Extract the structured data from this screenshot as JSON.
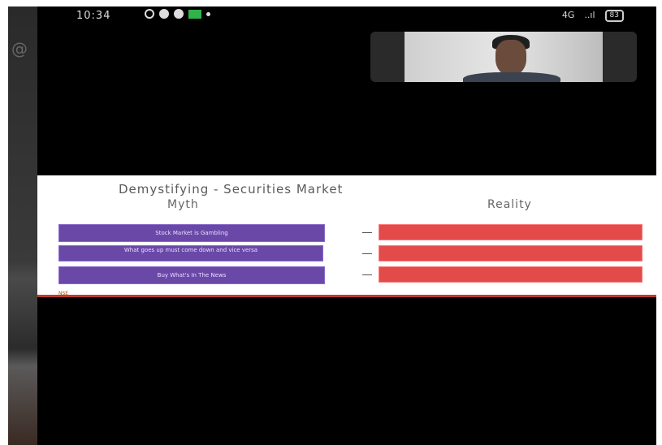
{
  "status_bar": {
    "time": "10:34",
    "network": "4G",
    "signal": "..ıl",
    "battery": "83"
  },
  "slide": {
    "title": "Demystifying -  Securities Market",
    "myth_heading": "Myth",
    "reality_heading": "Reality",
    "rows": [
      {
        "myth": "Stock Market is Gambling",
        "reality": ""
      },
      {
        "myth": "What goes up must come down and vice versa",
        "reality": ""
      },
      {
        "myth": "Buy What's In The News",
        "reality": ""
      }
    ],
    "logo_text": "NSE"
  },
  "colors": {
    "myth_box": "#6a48a8",
    "reality_box": "#e34a4a",
    "background": "#000000"
  }
}
